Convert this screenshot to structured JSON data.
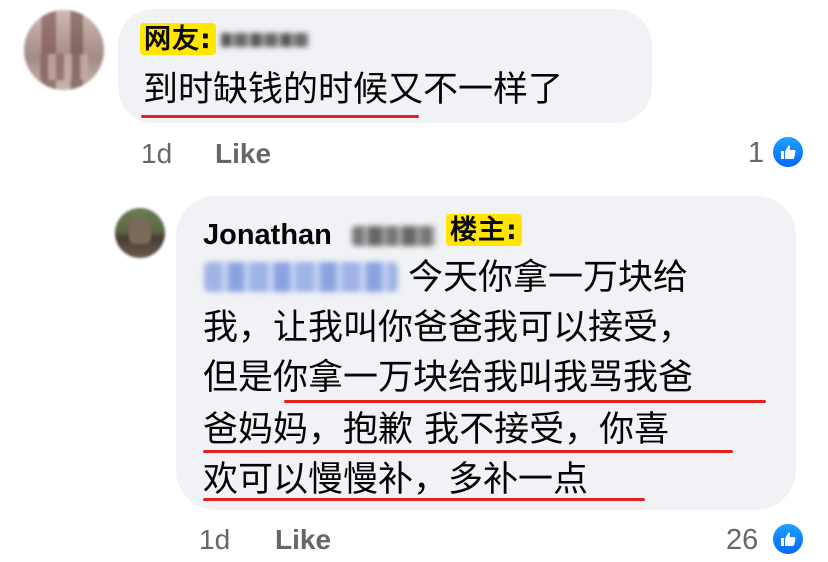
{
  "comments": [
    {
      "tag": "网友:",
      "text": "到时缺钱的时候又不一样了",
      "time": "1d",
      "like_label": "Like",
      "reaction_count": "1"
    },
    {
      "author": "Jonathan",
      "tag": "楼主:",
      "lines": [
        "今天你拿一万块给",
        "我，让我叫你爸爸我可以接受，",
        "但是你拿一万块给我叫我骂我爸",
        "爸妈妈，抱歉 我不接受，你喜",
        "欢可以慢慢补，多补一点"
      ],
      "time": "1d",
      "like_label": "Like",
      "reaction_count": "26"
    }
  ],
  "colors": {
    "bubble": "#f0f2f5",
    "tag_highlight": "#ffe500",
    "underline": "#e3201b",
    "like_blue": "#0866ff",
    "meta_text": "#65676b"
  },
  "icons": {
    "reaction": "thumbs-up-icon"
  }
}
